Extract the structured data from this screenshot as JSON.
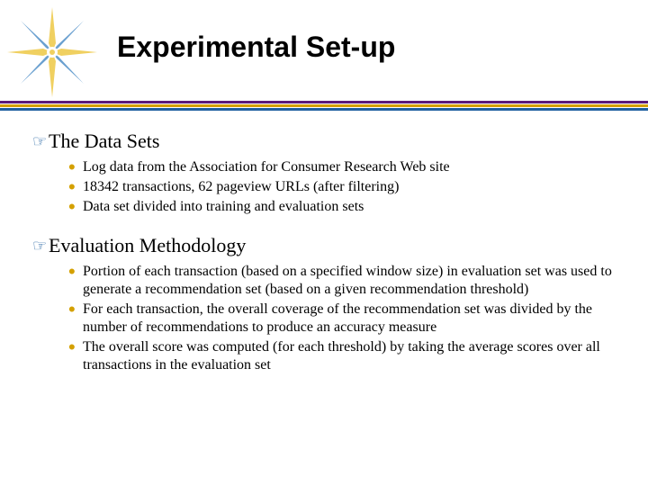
{
  "title": "Experimental Set-up",
  "sections": [
    {
      "heading": "The Data Sets",
      "items": [
        "Log data from the Association for Consumer Research Web site",
        "18342 transactions, 62 pageview URLs (after filtering)",
        "Data set divided into training and evaluation sets"
      ]
    },
    {
      "heading": "Evaluation Methodology",
      "items": [
        "Portion of each transaction (based on a specified window size) in evaluation set was used to generate a recommendation set (based on a given recommendation threshold)",
        "For each transaction, the overall coverage of the recommendation set was divided by the number of recommendations to produce an accuracy measure",
        "The overall score was computed (for each threshold) by taking the average scores over all transactions in the evaluation set"
      ]
    }
  ]
}
